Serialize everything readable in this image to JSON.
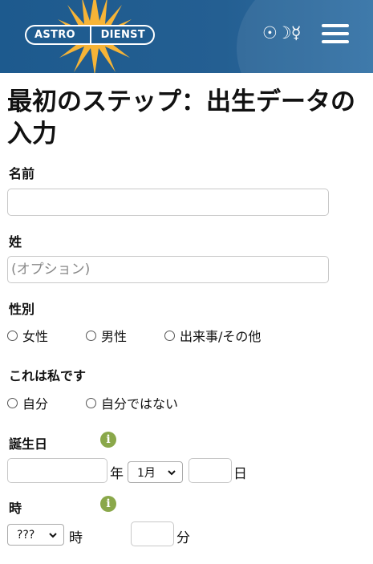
{
  "header": {
    "logo_left": "ASTRO",
    "logo_right": "DIENST",
    "planet_symbols": "☉☽☿",
    "colors": {
      "bar": "#1f5c90",
      "sun": "#f6b437",
      "info": "#8aa84a"
    }
  },
  "page": {
    "title": "最初のステップ：出生データの入力"
  },
  "form": {
    "first_name_label": "名前",
    "first_name_value": "",
    "last_name_label": "姓",
    "last_name_placeholder": "(オプション)",
    "gender_label": "性別",
    "gender_options": [
      "女性",
      "男性",
      "出来事/その他"
    ],
    "self_label": "これは私です",
    "self_options": [
      "自分",
      "自分ではない"
    ],
    "birthdate_label": "誕生日",
    "year_unit": "年",
    "month_selected": "1月",
    "day_unit": "日",
    "time_label": "時",
    "hour_selected": "???",
    "hour_unit": "時",
    "minute_unit": "分"
  }
}
